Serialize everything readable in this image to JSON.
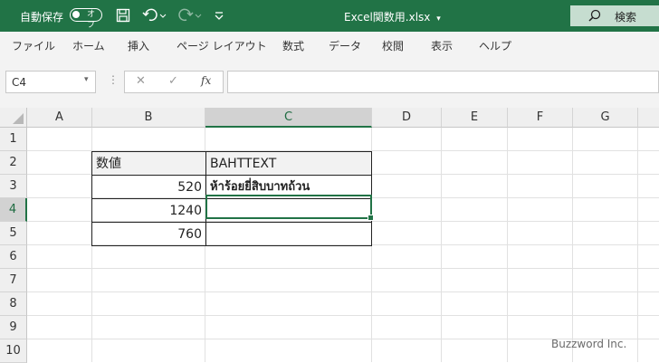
{
  "title_bar": {
    "autosave_label": "自動保存",
    "autosave_state": "オフ",
    "filename": "Excel関数用.xlsx",
    "filename_caret": "▾",
    "search_label": "検索",
    "accent_color": "#217346"
  },
  "ribbon": {
    "tabs": [
      "ファイル",
      "ホーム",
      "挿入",
      "ページ レイアウト",
      "数式",
      "データ",
      "校閲",
      "表示",
      "ヘルプ"
    ]
  },
  "formula_bar": {
    "name_box": "C4",
    "name_box_caret": "▾",
    "cancel_symbol": "✕",
    "enter_symbol": "✓",
    "function_symbol": "fx",
    "formula": ""
  },
  "sheet": {
    "columns": [
      "A",
      "B",
      "C",
      "D",
      "E",
      "F",
      "G"
    ],
    "rows": [
      "1",
      "2",
      "3",
      "4",
      "5",
      "6",
      "7",
      "8",
      "9",
      "10"
    ],
    "selected_column": "C",
    "selected_row": "4",
    "cells": {
      "B2": "数値",
      "C2": "BAHTTEXT",
      "B3": "520",
      "C3": "ห้าร้อยยี่สิบบาทถ้วน",
      "B4": "1240",
      "C4": "",
      "B5": "760",
      "C5": ""
    }
  },
  "watermark": "Buzzword Inc."
}
